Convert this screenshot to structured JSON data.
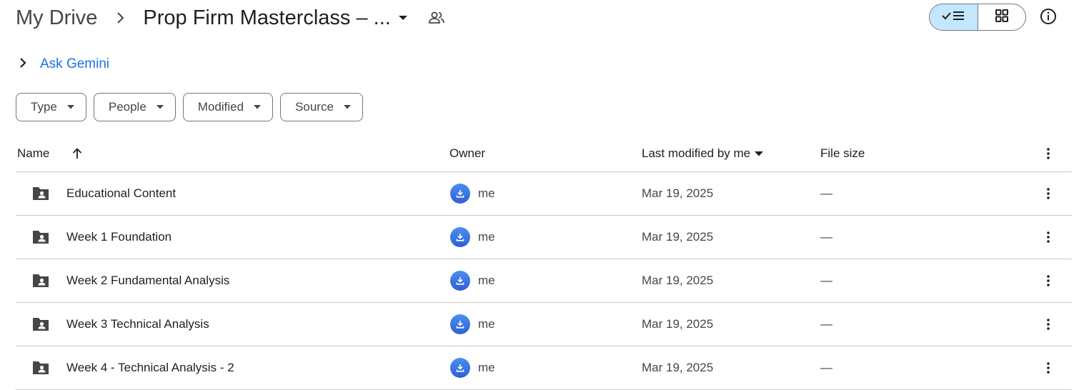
{
  "breadcrumb": {
    "root": "My Drive",
    "current": "Prop Firm Masterclass – ..."
  },
  "icons": {
    "separator": "chevron-right-icon",
    "folder_menu": "caret-down-icon",
    "shared": "people-icon",
    "list_view": "check-list-icon",
    "grid_view": "grid-icon",
    "info": "info-icon",
    "folder": "shared-folder-icon",
    "owner": "download-avatar-icon",
    "more": "more-vertical-icon"
  },
  "gemini": {
    "label": "Ask Gemini"
  },
  "filters": [
    {
      "label": "Type"
    },
    {
      "label": "People"
    },
    {
      "label": "Modified"
    },
    {
      "label": "Source"
    }
  ],
  "columns": {
    "name": "Name",
    "owner": "Owner",
    "modified": "Last modified by me",
    "size": "File size"
  },
  "rows": [
    {
      "name": "Educational Content",
      "owner": "me",
      "modified": "Mar 19, 2025",
      "size": "—"
    },
    {
      "name": "Week 1 Foundation",
      "owner": "me",
      "modified": "Mar 19, 2025",
      "size": "—"
    },
    {
      "name": "Week 2 Fundamental Analysis",
      "owner": "me",
      "modified": "Mar 19, 2025",
      "size": "—"
    },
    {
      "name": "Week 3 Technical Analysis",
      "owner": "me",
      "modified": "Mar 19, 2025",
      "size": "—"
    },
    {
      "name": "Week 4 - Technical Analysis - 2",
      "owner": "me",
      "modified": "Mar 19, 2025",
      "size": "—"
    }
  ],
  "colors": {
    "accent": "#1a73e8",
    "selected_toggle": "#c2e7ff",
    "text": "#1f1f1f",
    "muted": "#444746",
    "divider": "#c7c7c7"
  }
}
